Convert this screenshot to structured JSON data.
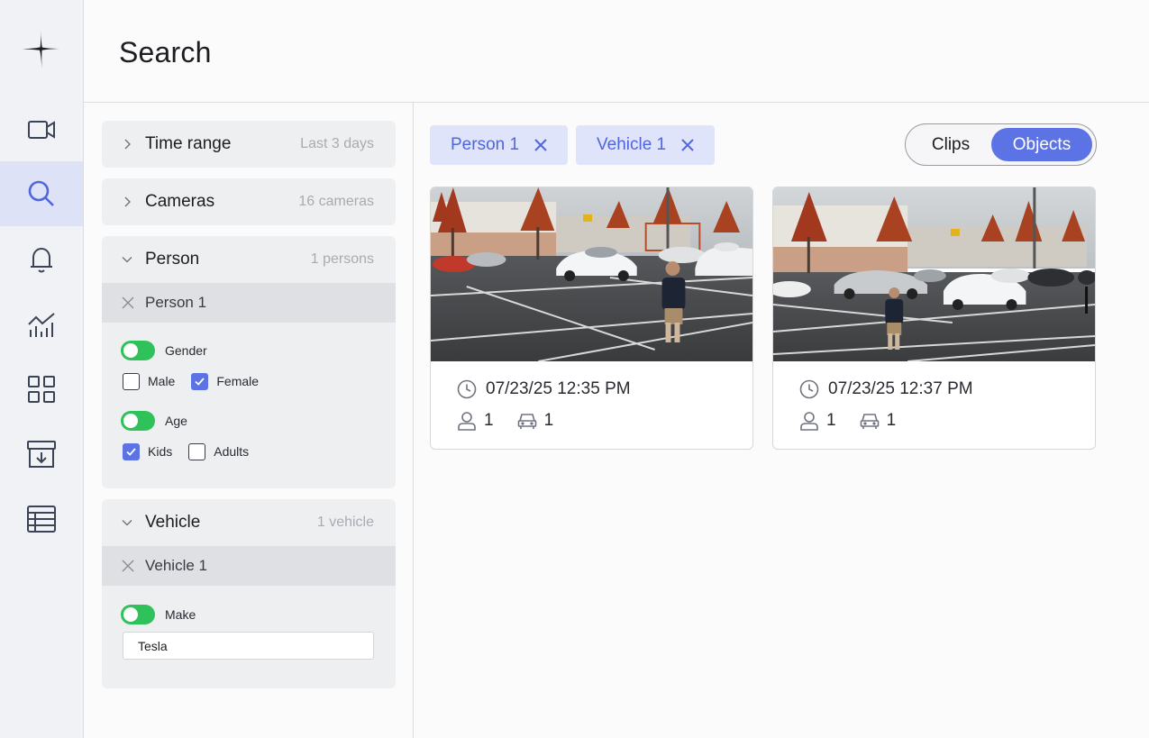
{
  "header": {
    "title": "Search"
  },
  "sidebar": {
    "items": [
      {
        "icon": "video-camera-icon"
      },
      {
        "icon": "search-icon",
        "active": true
      },
      {
        "icon": "bell-icon"
      },
      {
        "icon": "analytics-icon"
      },
      {
        "icon": "grid-icon"
      },
      {
        "icon": "archive-download-icon"
      },
      {
        "icon": "table-icon"
      }
    ]
  },
  "filters": {
    "time_range": {
      "label": "Time range",
      "value": "Last 3 days"
    },
    "cameras": {
      "label": "Cameras",
      "value": "16 cameras"
    },
    "person": {
      "label": "Person",
      "count": "1 persons",
      "item": "Person 1",
      "gender": {
        "label": "Gender",
        "enabled": true,
        "options": [
          {
            "label": "Male",
            "checked": false
          },
          {
            "label": "Female",
            "checked": true
          }
        ]
      },
      "age": {
        "label": "Age",
        "enabled": true,
        "options": [
          {
            "label": "Kids",
            "checked": true
          },
          {
            "label": "Adults",
            "checked": false
          }
        ]
      }
    },
    "vehicle": {
      "label": "Vehicle",
      "count": "1 vehicle",
      "item": "Vehicle 1",
      "make": {
        "label": "Make",
        "enabled": true,
        "value": "Tesla"
      }
    }
  },
  "results": {
    "chips": [
      {
        "label": "Person 1"
      },
      {
        "label": "Vehicle 1"
      }
    ],
    "view_toggle": {
      "options": [
        "Clips",
        "Objects"
      ],
      "selected": "Objects"
    },
    "items": [
      {
        "time": "07/23/25 12:35 PM",
        "persons": "1",
        "vehicles": "1"
      },
      {
        "time": "07/23/25 12:37 PM",
        "persons": "1",
        "vehicles": "1"
      }
    ]
  },
  "colors": {
    "accent": "#5c73e6",
    "toggle_on": "#2fc25b",
    "chip_bg": "#dfe4fa",
    "chip_text": "#5066db"
  }
}
